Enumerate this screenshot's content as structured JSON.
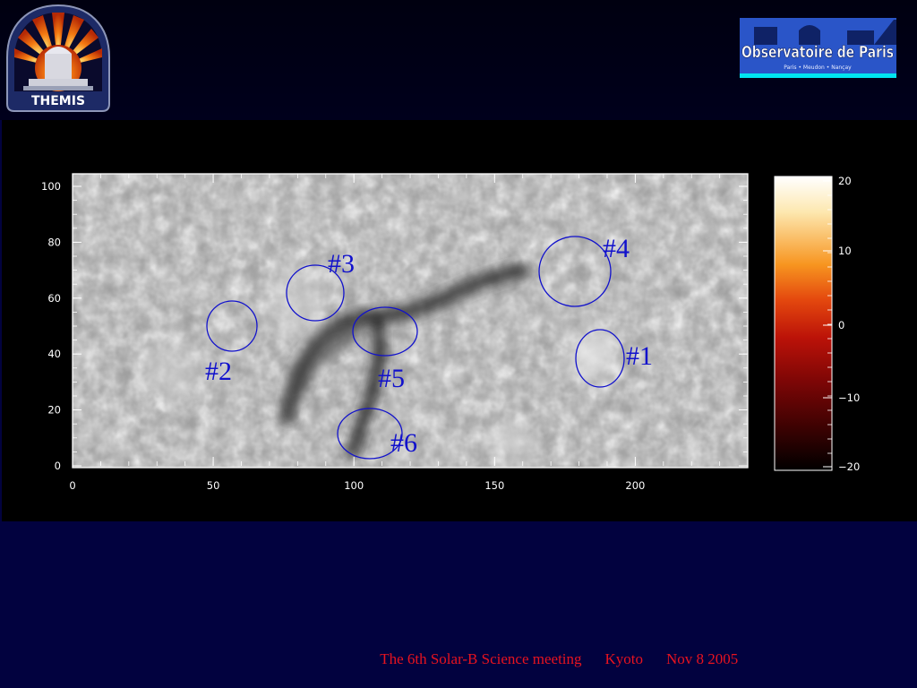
{
  "header": {
    "themis_logo_text": "THEMIS",
    "observatory_logo": {
      "name": "Observatoire de Paris",
      "sites": "Paris • Meudon • Nançay"
    }
  },
  "plot": {
    "x_ticks": [
      "0",
      "50",
      "100",
      "150",
      "200"
    ],
    "y_ticks": [
      "0",
      "20",
      "40",
      "60",
      "80",
      "100"
    ],
    "colorbar_ticks": [
      "20",
      "10",
      "0",
      "−10",
      "−20"
    ],
    "regions": [
      {
        "label": "#1"
      },
      {
        "label": "#2"
      },
      {
        "label": "#3"
      },
      {
        "label": "#4"
      },
      {
        "label": "#5"
      },
      {
        "label": "#6"
      }
    ]
  },
  "footer": {
    "meeting": "The 6th Solar-B Science meeting",
    "location": "Kyoto",
    "date": "Nov 8 2005"
  },
  "colors": {
    "background": "#02023f",
    "footer_text": "#e8131f",
    "region_outline": "#1111cc",
    "observatory_banner": "#2a55c8"
  }
}
